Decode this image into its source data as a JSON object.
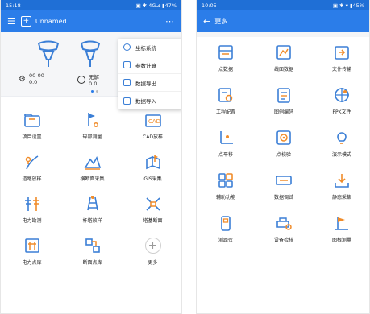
{
  "left": {
    "status": {
      "time": "15:18",
      "right": "▣ ✱ 4G⊿ ▮47%"
    },
    "appbar": {
      "menu_icon": "menu-icon",
      "title": "Unnamed",
      "more": "⋯"
    },
    "device": {
      "sat_value": "00-00",
      "sat_sub": "0.0",
      "fix_value": "无解",
      "fix_sub": "0.0",
      "page_index": 0
    },
    "dropdown": [
      {
        "label": "坐标系统",
        "icon": "globe-icon"
      },
      {
        "label": "参数计算",
        "icon": "calculator-icon"
      },
      {
        "label": "数据导出",
        "icon": "export-icon"
      },
      {
        "label": "数据导入",
        "icon": "import-icon"
      }
    ],
    "tiles": [
      {
        "label": "项目设置",
        "icon": "folder-icon"
      },
      {
        "label": "碎部测量",
        "icon": "flag-point-icon"
      },
      {
        "label": "CAD放样",
        "icon": "cad-icon"
      },
      {
        "label": "道路放样",
        "icon": "road-stakeout-icon"
      },
      {
        "label": "横断面采集",
        "icon": "cross-section-icon"
      },
      {
        "label": "GIS采集",
        "icon": "gis-icon"
      },
      {
        "label": "电力勘测",
        "icon": "power-tower-icon"
      },
      {
        "label": "杆塔放样",
        "icon": "tower-stakeout-icon"
      },
      {
        "label": "塔基断面",
        "icon": "tower-base-icon"
      },
      {
        "label": "电力点库",
        "icon": "power-library-icon"
      },
      {
        "label": "断面点库",
        "icon": "section-library-icon"
      },
      {
        "label": "更多",
        "icon": "plus-icon"
      }
    ]
  },
  "right": {
    "status": {
      "time": "10:05",
      "right": "▣ ✱ ▾ ▮45%"
    },
    "appbar": {
      "back": "←",
      "title": "更多"
    },
    "tiles": [
      {
        "label": "点数据",
        "icon": "point-data-icon"
      },
      {
        "label": "线面数据",
        "icon": "line-data-icon"
      },
      {
        "label": "文件传输",
        "icon": "file-transfer-icon"
      },
      {
        "label": "工程配置",
        "icon": "project-config-icon"
      },
      {
        "label": "图例编码",
        "icon": "legend-code-icon"
      },
      {
        "label": "PPK文件",
        "icon": "ppk-icon"
      },
      {
        "label": "点平移",
        "icon": "point-translate-icon"
      },
      {
        "label": "点校验",
        "icon": "point-check-icon"
      },
      {
        "label": "演示模式",
        "icon": "demo-bulb-icon"
      },
      {
        "label": "辅助功能",
        "icon": "tools-grid-icon"
      },
      {
        "label": "数据调试",
        "icon": "data-debug-icon"
      },
      {
        "label": "静态采集",
        "icon": "static-collect-icon"
      },
      {
        "label": "测距仪",
        "icon": "rangefinder-icon"
      },
      {
        "label": "设备检核",
        "icon": "device-check-icon"
      },
      {
        "label": "图根测量",
        "icon": "control-survey-icon"
      }
    ]
  },
  "colors": {
    "primary": "#2b7de9",
    "status": "#1f6fd6",
    "icon_blue": "#3b7fd6",
    "icon_orange": "#f08c2a"
  }
}
